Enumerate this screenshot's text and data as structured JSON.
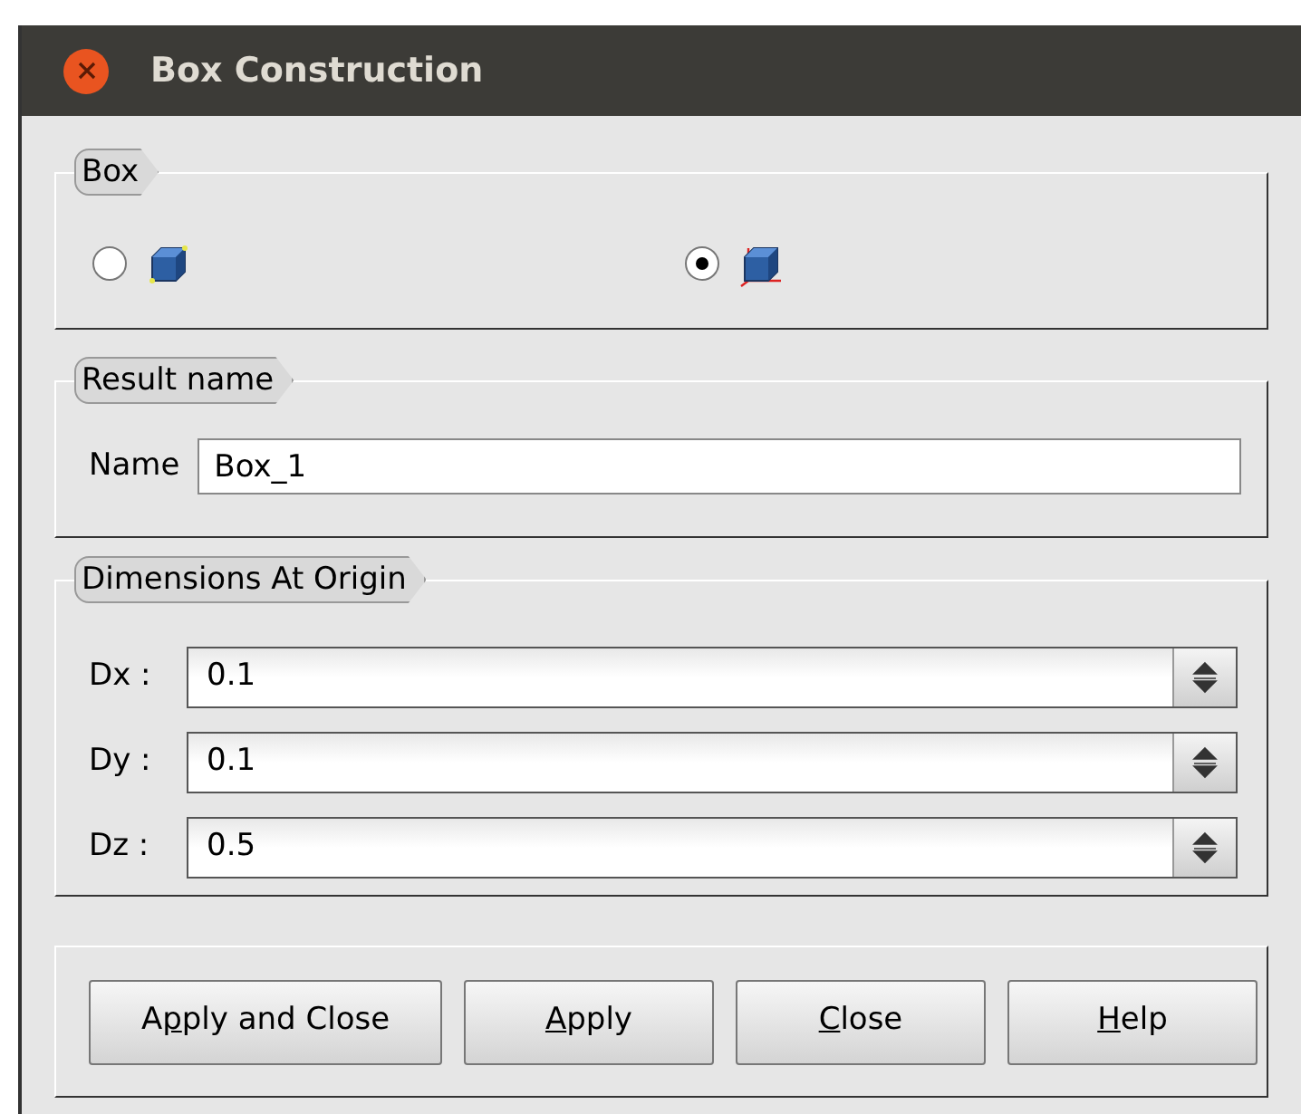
{
  "window": {
    "title": "Box Construction"
  },
  "box_group": {
    "title": "Box",
    "options": [
      {
        "kind": "box",
        "selected": false
      },
      {
        "kind": "box-at-origin",
        "selected": true
      }
    ]
  },
  "result_group": {
    "title": "Result name",
    "label": "Name",
    "value": "Box_1"
  },
  "dimensions_group": {
    "title": "Dimensions At Origin",
    "fields": [
      {
        "label": "Dx :",
        "value": "0.1"
      },
      {
        "label": "Dy :",
        "value": "0.1"
      },
      {
        "label": "Dz :",
        "value": "0.5"
      }
    ]
  },
  "buttons": [
    {
      "before": "A",
      "key": "p",
      "after": "ply and Close"
    },
    {
      "key": "A",
      "after": "pply"
    },
    {
      "key": "C",
      "after": "lose"
    },
    {
      "key": "H",
      "after": "elp"
    }
  ]
}
